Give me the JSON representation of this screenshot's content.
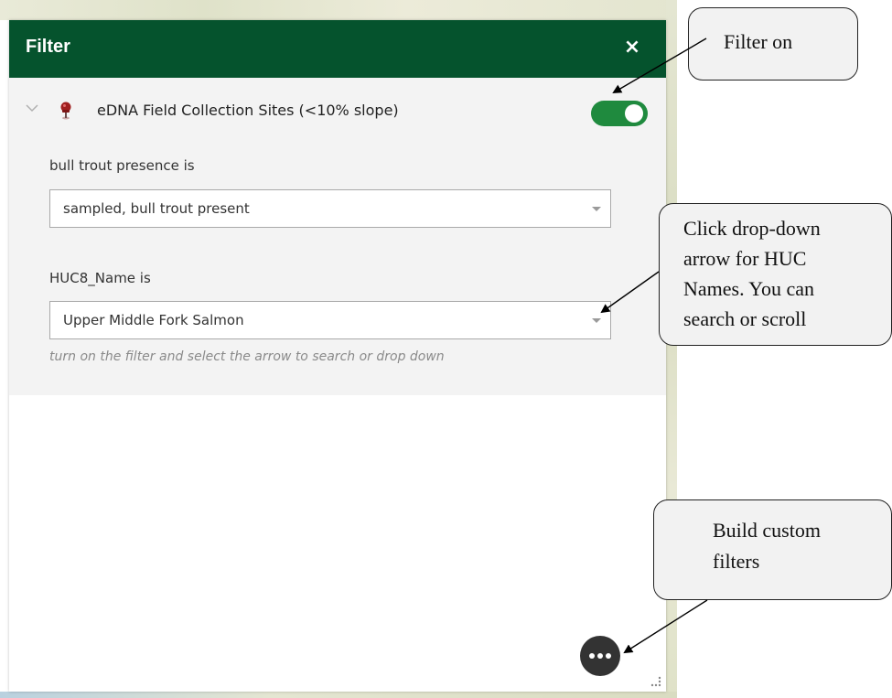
{
  "panel": {
    "title": "Filter",
    "close_symbol": "×"
  },
  "layer": {
    "name": "eDNA Field Collection Sites (<10% slope)",
    "icon": "pushpin-icon",
    "filter_enabled": true
  },
  "filters": [
    {
      "label": "bull trout presence is",
      "selected": "sampled, bull trout present"
    },
    {
      "label": "HUC8_Name is",
      "selected": "Upper Middle Fork Salmon",
      "hint": "turn on the filter and select the arrow to search or drop down"
    }
  ],
  "more_button_icon": "ellipsis-icon",
  "callouts": {
    "filter_on": "Filter on",
    "dropdown": [
      "Click drop-down",
      "arrow for HUC",
      "Names. You can",
      "search or scroll"
    ],
    "custom": [
      "Build custom",
      "filters"
    ]
  },
  "colors": {
    "header": "#05532d",
    "toggle_on": "#1f8a3e"
  }
}
